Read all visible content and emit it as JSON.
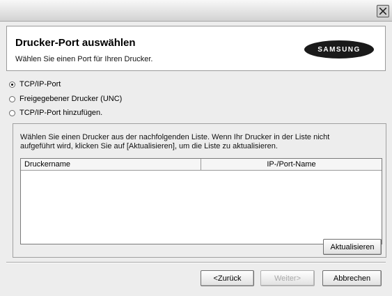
{
  "header": {
    "title": "Drucker-Port auswählen",
    "subtitle": "Wählen Sie einen Port für Ihren Drucker.",
    "logo_text": "SAMSUNG"
  },
  "port_options": [
    {
      "label": "TCP/IP-Port",
      "checked": true
    },
    {
      "label": "Freigegebener Drucker (UNC)",
      "checked": false
    },
    {
      "label": "TCP/IP-Port hinzufügen.",
      "checked": false
    }
  ],
  "printer_group": {
    "instruction_line1": "Wählen Sie einen Drucker aus der nachfolgenden Liste. Wenn Ihr Drucker in der Liste nicht",
    "instruction_line2": "aufgeführt wird, klicken Sie auf [Aktualisieren], um die Liste zu aktualisieren.",
    "columns": [
      "Druckername",
      "IP-/Port-Name"
    ],
    "rows": [],
    "refresh_label": "Aktualisieren"
  },
  "footer": {
    "back_label": "<Zurück",
    "next_label": "Weiter>",
    "cancel_label": "Abbrechen"
  },
  "icons": {
    "close": "close-icon"
  }
}
